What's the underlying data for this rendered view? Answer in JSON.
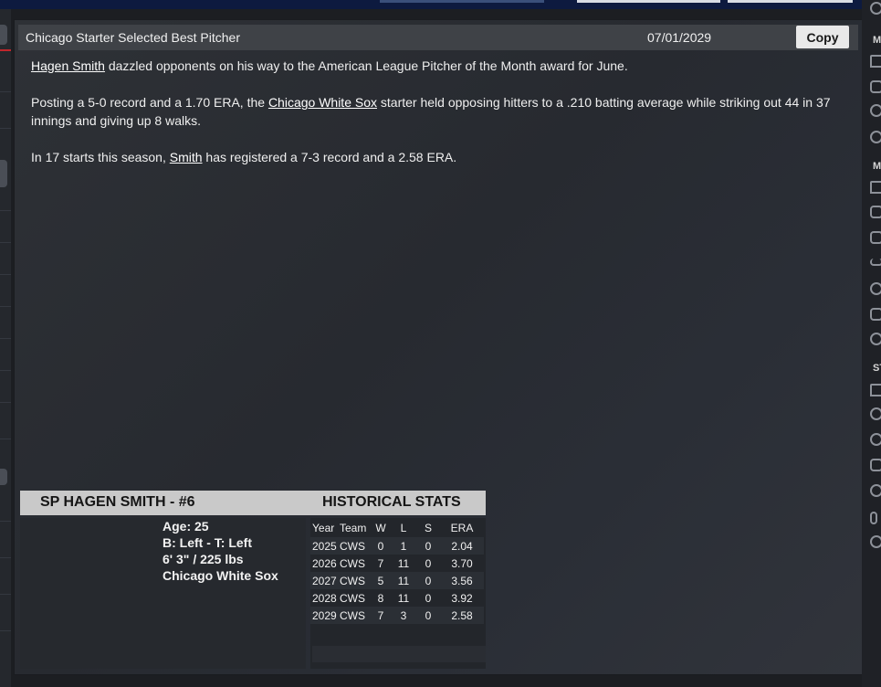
{
  "news": {
    "headline": "Chicago Starter Selected Best Pitcher",
    "date": "07/01/2029",
    "copy_label": "Copy",
    "p1": {
      "player_link": "Hagen Smith",
      "rest": " dazzled opponents on his way to the American League Pitcher of the Month award for June."
    },
    "p2": {
      "lead": "Posting a 5-0 record and a 1.70 ERA, the ",
      "team_link": "Chicago White Sox",
      "rest": " starter held opposing hitters to a .210 batting average while striking out 44 in 37 innings and giving up 8 walks."
    },
    "p3": {
      "lead": "In 17 starts this season, ",
      "player_link": "Smith",
      "rest": " has registered a 7-3 record and a 2.58 ERA."
    }
  },
  "player_card": {
    "title": "SP HAGEN SMITH - #6",
    "stats_title": "HISTORICAL STATS",
    "age": "Age: 25",
    "bats_throws": "B: Left - T: Left",
    "height_weight": "6' 3\"  / 225 lbs",
    "team": "Chicago White Sox",
    "columns": [
      "Year",
      "Team",
      "W",
      "L",
      "S",
      "ERA"
    ],
    "rows": [
      [
        "2025",
        "CWS",
        "0",
        "1",
        "0",
        "2.04"
      ],
      [
        "2026",
        "CWS",
        "7",
        "11",
        "0",
        "3.70"
      ],
      [
        "2027",
        "CWS",
        "5",
        "11",
        "0",
        "3.56"
      ],
      [
        "2028",
        "CWS",
        "8",
        "11",
        "0",
        "3.92"
      ],
      [
        "2029",
        "CWS",
        "7",
        "3",
        "0",
        "2.58"
      ]
    ]
  },
  "sidebar": {
    "labels": [
      "M",
      "M",
      "ST"
    ],
    "icons": [
      "settings-icon",
      "home-icon",
      "mail-icon",
      "refresh-icon",
      "gear-icon",
      "home-icon",
      "tag-icon",
      "list-icon",
      "chart-icon",
      "ball-icon",
      "arrows-icon",
      "gear-icon",
      "home-icon",
      "phone-icon",
      "ball-icon",
      "arrows-icon",
      "ball-icon",
      "dollar-icon",
      "gear-icon"
    ]
  }
}
